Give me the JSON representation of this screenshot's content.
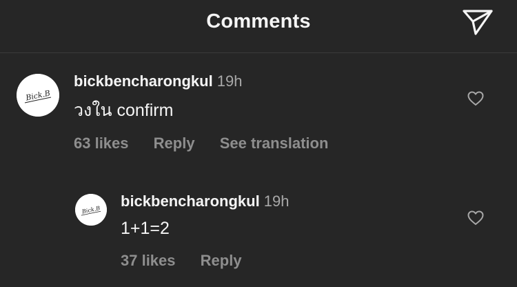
{
  "header": {
    "title": "Comments",
    "send_icon": "paper-plane-icon"
  },
  "comments": [
    {
      "username": "bickbencharongkul",
      "time": "19h",
      "text": "วงใน confirm",
      "likes": "63 likes",
      "reply_label": "Reply",
      "translate_label": "See translation",
      "avatar_text": "Bick.B",
      "like_icon": "heart-icon"
    },
    {
      "username": "bickbencharongkul",
      "time": "19h",
      "text": "1+1=2",
      "likes": "37 likes",
      "reply_label": "Reply",
      "avatar_text": "Bick.B",
      "like_icon": "heart-icon"
    }
  ],
  "colors": {
    "background": "#262626",
    "primary_text": "#f5f5f5",
    "secondary_text": "#8e8e8e",
    "divider": "#3a3a3a"
  }
}
